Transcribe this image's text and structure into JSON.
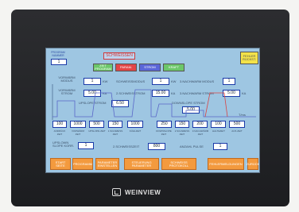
{
  "device": {
    "brand": "WEINVIEW"
  },
  "header": {
    "top_left_label": "PROGRAM NUMMER",
    "top_left_value": "1",
    "title": "SCHWEISSEN",
    "tabs": [
      "ZEIT PROGRAM",
      "PARAM.",
      "STROM",
      "KRAFT"
    ],
    "right_button": "FEHLER RÜCKST."
  },
  "params": {
    "vorwaerm_modus_label": "VORWÄRM MODUS",
    "vorwaerm_modus_value": "1",
    "vorwaerm_strom_label": "VORWÄRM STROM",
    "vorwaerm_strom_value": "5.00",
    "unit_ka": "KA",
    "unit_ka2": "KA",
    "unit_ka3": "KA",
    "unit_kw": "KW",
    "unit_kw2": "KW",
    "schweissmodus_label": "SCHWEISSMODUS",
    "schweissmodus_value": "1",
    "schweissstrom_label": "2.SCHWEISSTROM",
    "schweissstrom_value": "15.00",
    "nachwaerm_modus_label": "3.NACHWARM MODUS",
    "nachwaerm_modus_value": "1",
    "nachwaerm_strom_label": "3.NACHWARM STROM",
    "nachwaerm_strom_value": "5.00",
    "upslope_strom_label": "UPSLOPE STROM",
    "upslope_strom_value": "6.50",
    "downslope_strom_label": "DOWNSLOPE STROM",
    "downslope_strom_value": "5.00",
    "time_unit": "T/ms"
  },
  "timeline": {
    "values": [
      "100",
      "1000",
      "500",
      "150",
      "1000",
      "250",
      "150",
      "200",
      "100",
      "500"
    ],
    "labels": [
      "ANDRÜCK ZEIT",
      "VORWÄRM ZEIT",
      "UPSLOPE ZEIT",
      "1.SCHWEISS ZEIT",
      "KÜHLZEIT",
      "DOWNSLOPE ZEIT",
      "2.SCHWEISS ZEIT",
      "3.NACHWÄRM ZEIT",
      "HALTEZEIT",
      "AUS ZEIT"
    ]
  },
  "bottom": {
    "upslope_label": "UPSLOWN SLOPE KORR.",
    "upslope_value": "1",
    "impulse_label": "2.SCHWEISSZEIT",
    "impulse_value": "800",
    "pulse_label": "ANZAHL PULSE",
    "pulse_value": "1"
  },
  "nav": [
    "START SEITE",
    "PROGRAMM",
    "PARAMETER EINSTELLEN",
    "STEUERUNG PARAMETER",
    "SCHWEISS PROTOKOLL",
    "FEHLERMELDUNGEN",
    "ZURÜCK"
  ]
}
